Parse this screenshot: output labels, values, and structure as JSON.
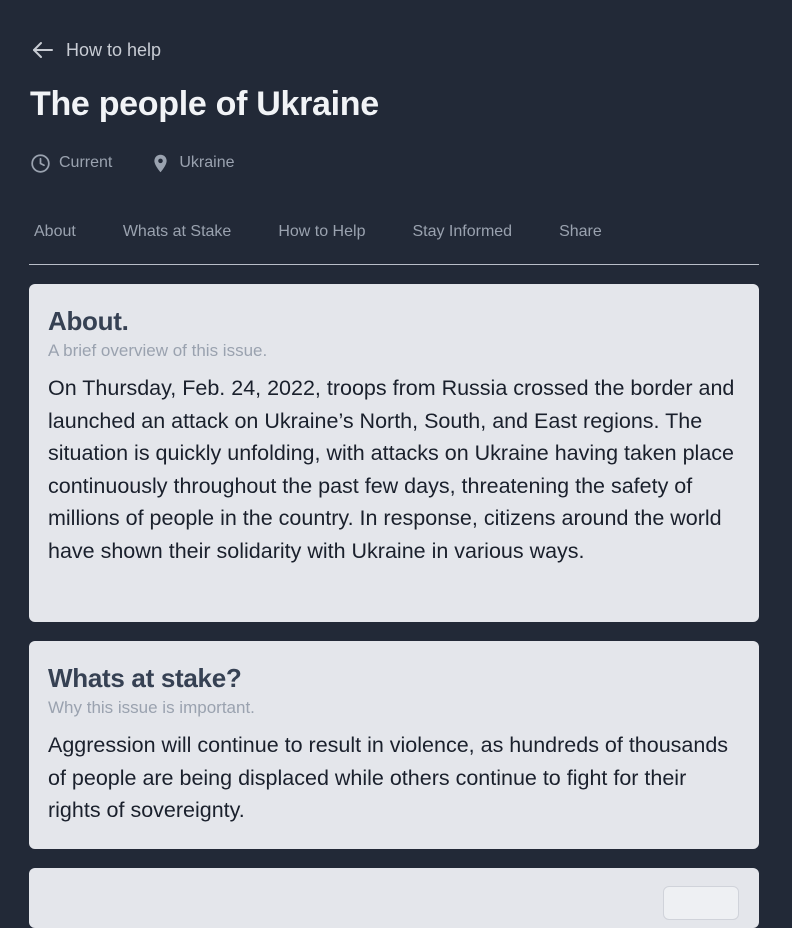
{
  "nav": {
    "back_label": "How to help",
    "back_icon": "arrow-left-icon"
  },
  "page": {
    "title": "The people of Ukraine"
  },
  "meta": {
    "status": "Current",
    "status_icon": "clock-icon",
    "location": "Ukraine",
    "location_icon": "map-pin-icon"
  },
  "tabs": [
    {
      "label": "About"
    },
    {
      "label": "Whats at Stake"
    },
    {
      "label": "How to Help"
    },
    {
      "label": "Stay Informed"
    },
    {
      "label": "Share"
    }
  ],
  "sections": {
    "about": {
      "title": "About.",
      "subtitle": "A brief overview of this issue.",
      "body": "On Thursday, Feb. 24, 2022, troops from Russia crossed the border and launched an attack on Ukraine’s North, South, and East regions. The situation is quickly unfolding, with attacks on Ukraine having taken place continuously throughout the past few days, threatening the safety of millions of people in the country. In response, citizens around the world have shown their solidarity with Ukraine in various ways."
    },
    "stake": {
      "title": "Whats at stake?",
      "subtitle": "Why this issue is important.",
      "body": "Aggression will continue to result in violence, as hundreds of thousands of people are being displaced while others continue to fight for their rights of sovereignty."
    }
  },
  "colors": {
    "background": "#222937",
    "card": "#e4e6eb",
    "heading": "#364153",
    "muted": "#9aa2af",
    "title": "#f1f3f6"
  }
}
